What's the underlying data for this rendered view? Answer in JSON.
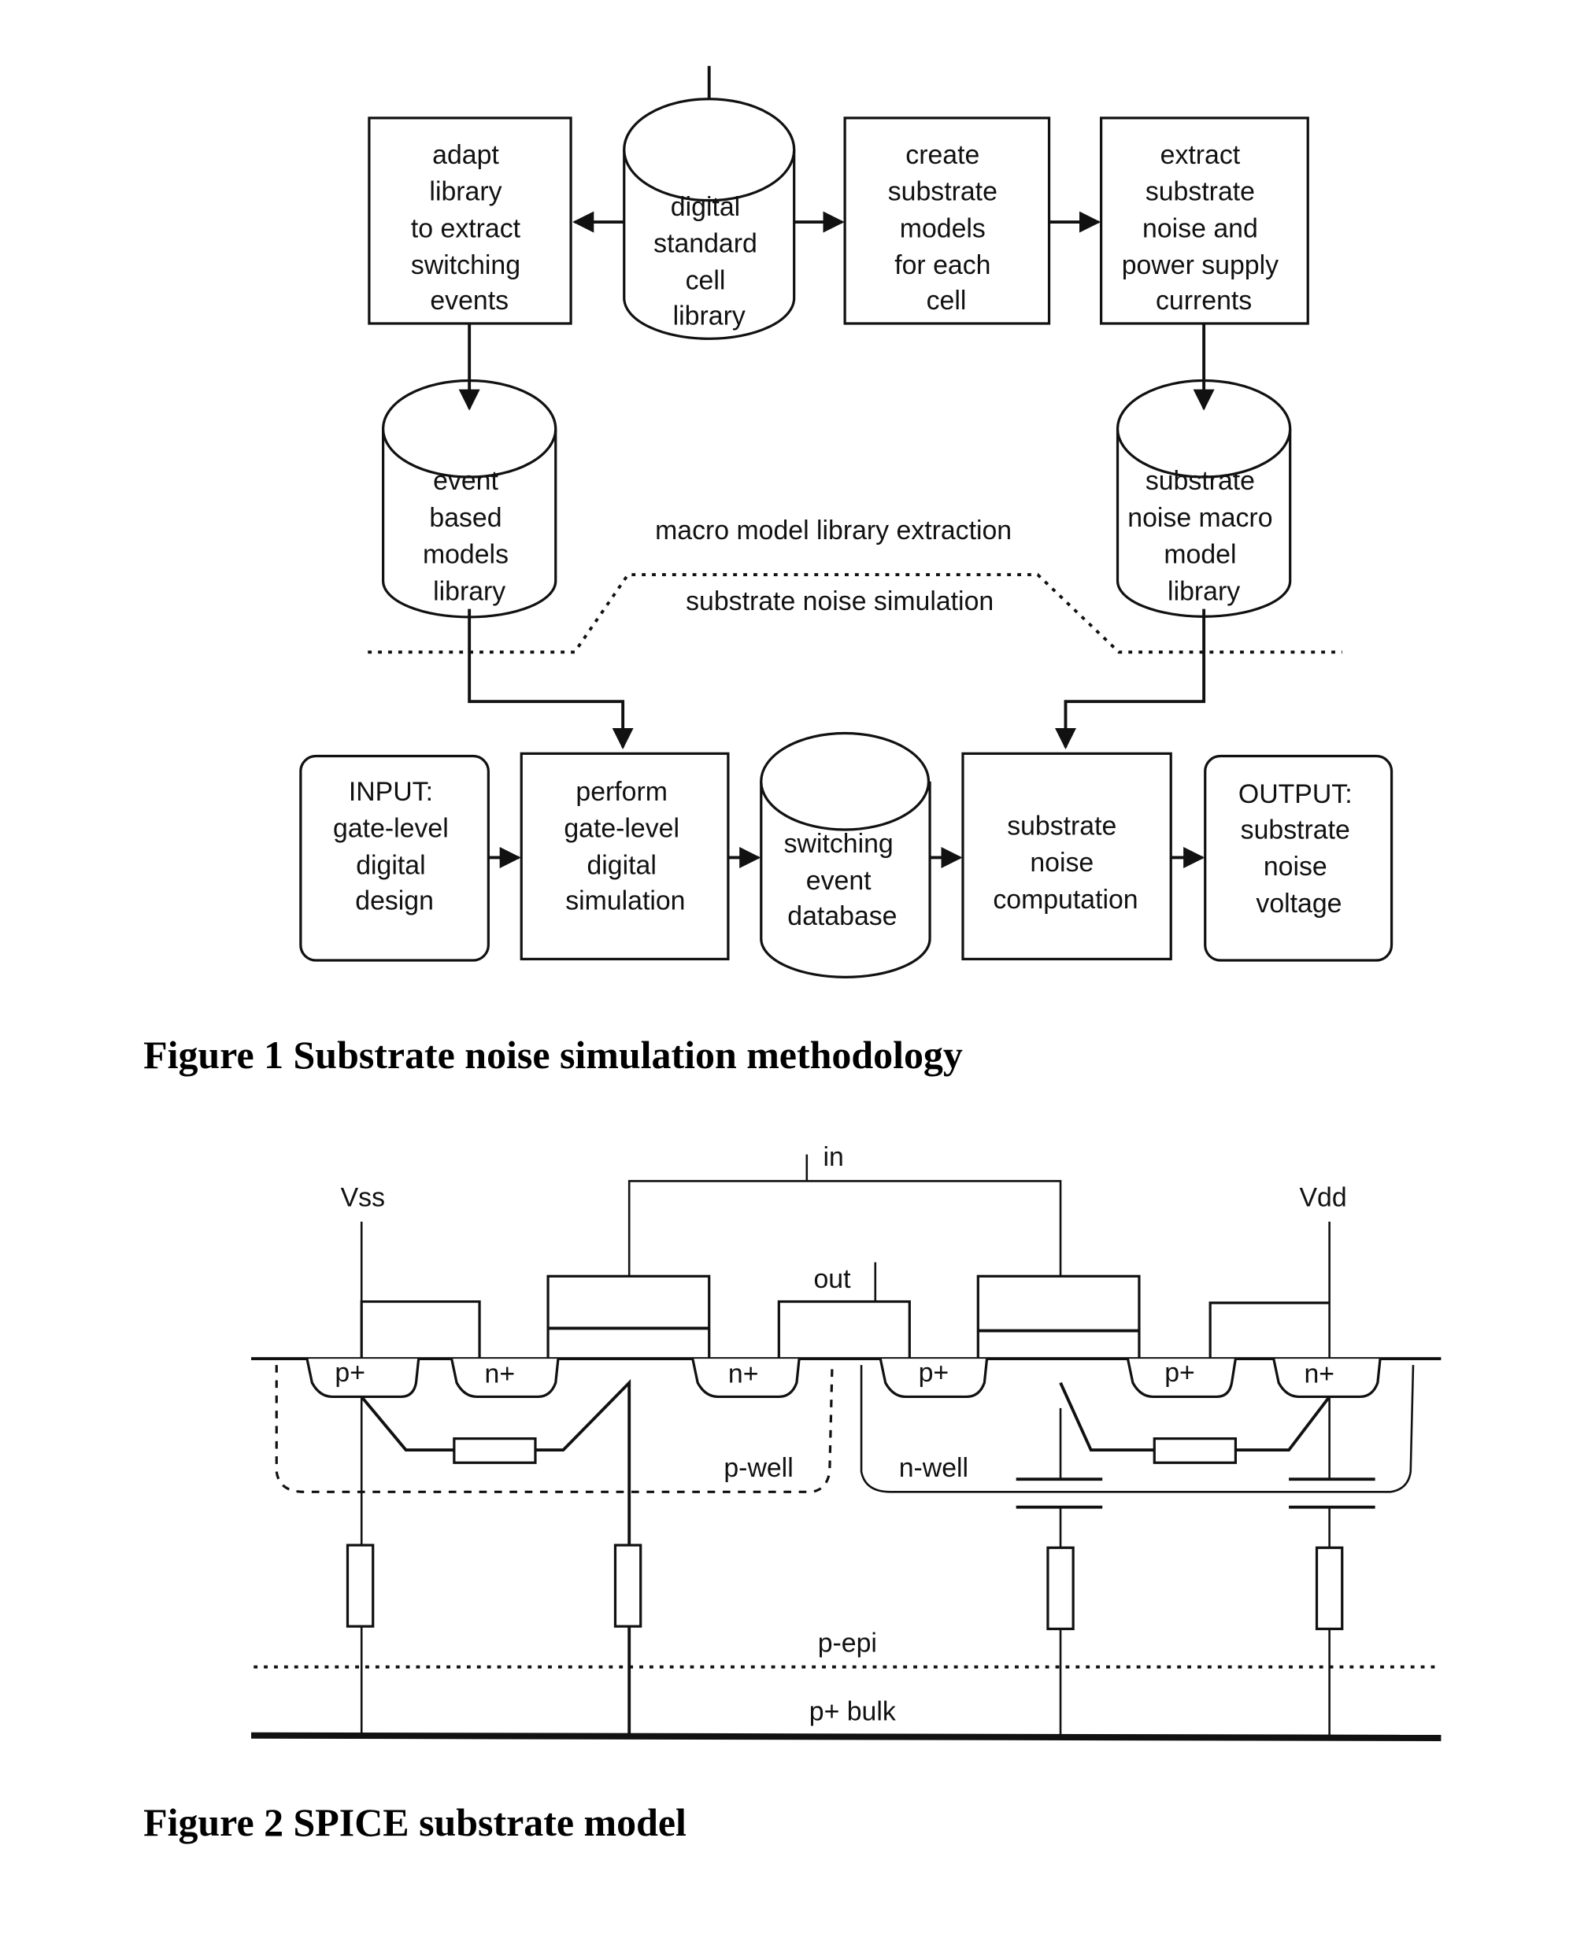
{
  "figure1": {
    "caption": "Figure 1 Substrate noise simulation methodology",
    "nodes": {
      "adapt_library": [
        "adapt",
        "library",
        "to extract",
        "switching",
        "events"
      ],
      "digital_library": [
        "digital",
        "standard",
        "cell",
        "library"
      ],
      "create_models": [
        "create",
        "substrate",
        "models",
        "for each",
        "cell"
      ],
      "extract_noise": [
        "extract",
        "substrate",
        "noise and",
        "power supply",
        "currents"
      ],
      "event_models_library": [
        "event",
        "based",
        "models",
        "library"
      ],
      "noise_macro_library": [
        "substrate",
        "noise macro",
        "model",
        "library"
      ],
      "input": [
        "INPUT:",
        "gate-level",
        "digital",
        "design"
      ],
      "gate_sim": [
        "perform",
        "gate-level",
        "digital",
        "simulation"
      ],
      "switching_db": [
        "switching",
        "event",
        "database"
      ],
      "noise_computation": [
        "substrate",
        "noise",
        "computation"
      ],
      "output": [
        "OUTPUT:",
        "substrate",
        "noise",
        "voltage"
      ]
    },
    "region_labels": {
      "upper": "macro model library extraction",
      "lower": "substrate noise simulation"
    }
  },
  "figure2": {
    "caption": "Figure 2 SPICE substrate model",
    "terminals": {
      "vss": "Vss",
      "vdd": "Vdd",
      "in": "in",
      "out": "out"
    },
    "diffusions": [
      "p+",
      "n+",
      "n+",
      "p+",
      "p+",
      "n+"
    ],
    "regions": {
      "p_well": "p-well",
      "n_well": "n-well",
      "p_epi": "p-epi",
      "p_bulk": "p+ bulk"
    }
  }
}
